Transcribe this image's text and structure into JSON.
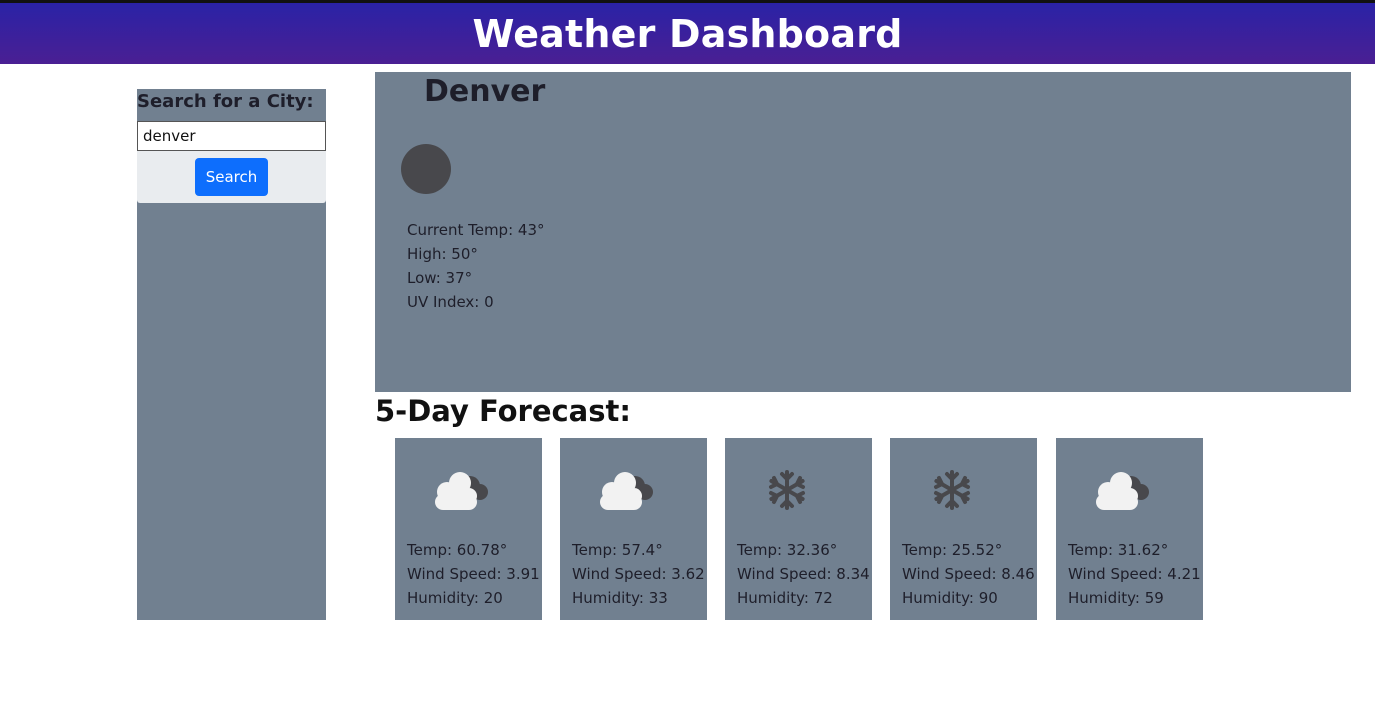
{
  "header": {
    "title": "Weather Dashboard"
  },
  "sidebar": {
    "label": "Search for a City:",
    "search_value": "denver",
    "search_button": "Search"
  },
  "current": {
    "city": "Denver",
    "temp": "Current Temp: 43°",
    "high": "High: 50°",
    "low": "Low: 37°",
    "uv": "UV Index: 0"
  },
  "forecast": {
    "title": "5-Day Forecast:",
    "days": [
      {
        "icon": "cloud-icon",
        "temp": "Temp: 60.78°",
        "wind": "Wind Speed: 3.91",
        "humidity": "Humidity: 20"
      },
      {
        "icon": "cloud-icon",
        "temp": "Temp: 57.4°",
        "wind": "Wind Speed: 3.62",
        "humidity": "Humidity: 33"
      },
      {
        "icon": "snowflake-icon",
        "temp": "Temp: 32.36°",
        "wind": "Wind Speed: 8.34",
        "humidity": "Humidity: 72"
      },
      {
        "icon": "snowflake-icon",
        "temp": "Temp: 25.52°",
        "wind": "Wind Speed: 8.46",
        "humidity": "Humidity: 90"
      },
      {
        "icon": "cloud-icon",
        "temp": "Temp: 31.62°",
        "wind": "Wind Speed: 4.21",
        "humidity": "Humidity: 59"
      }
    ]
  },
  "colors": {
    "header_gradient_top": "#2a22a6",
    "header_gradient_bottom": "#4a1f93",
    "panel": "#718090",
    "button": "#0d6efd"
  }
}
